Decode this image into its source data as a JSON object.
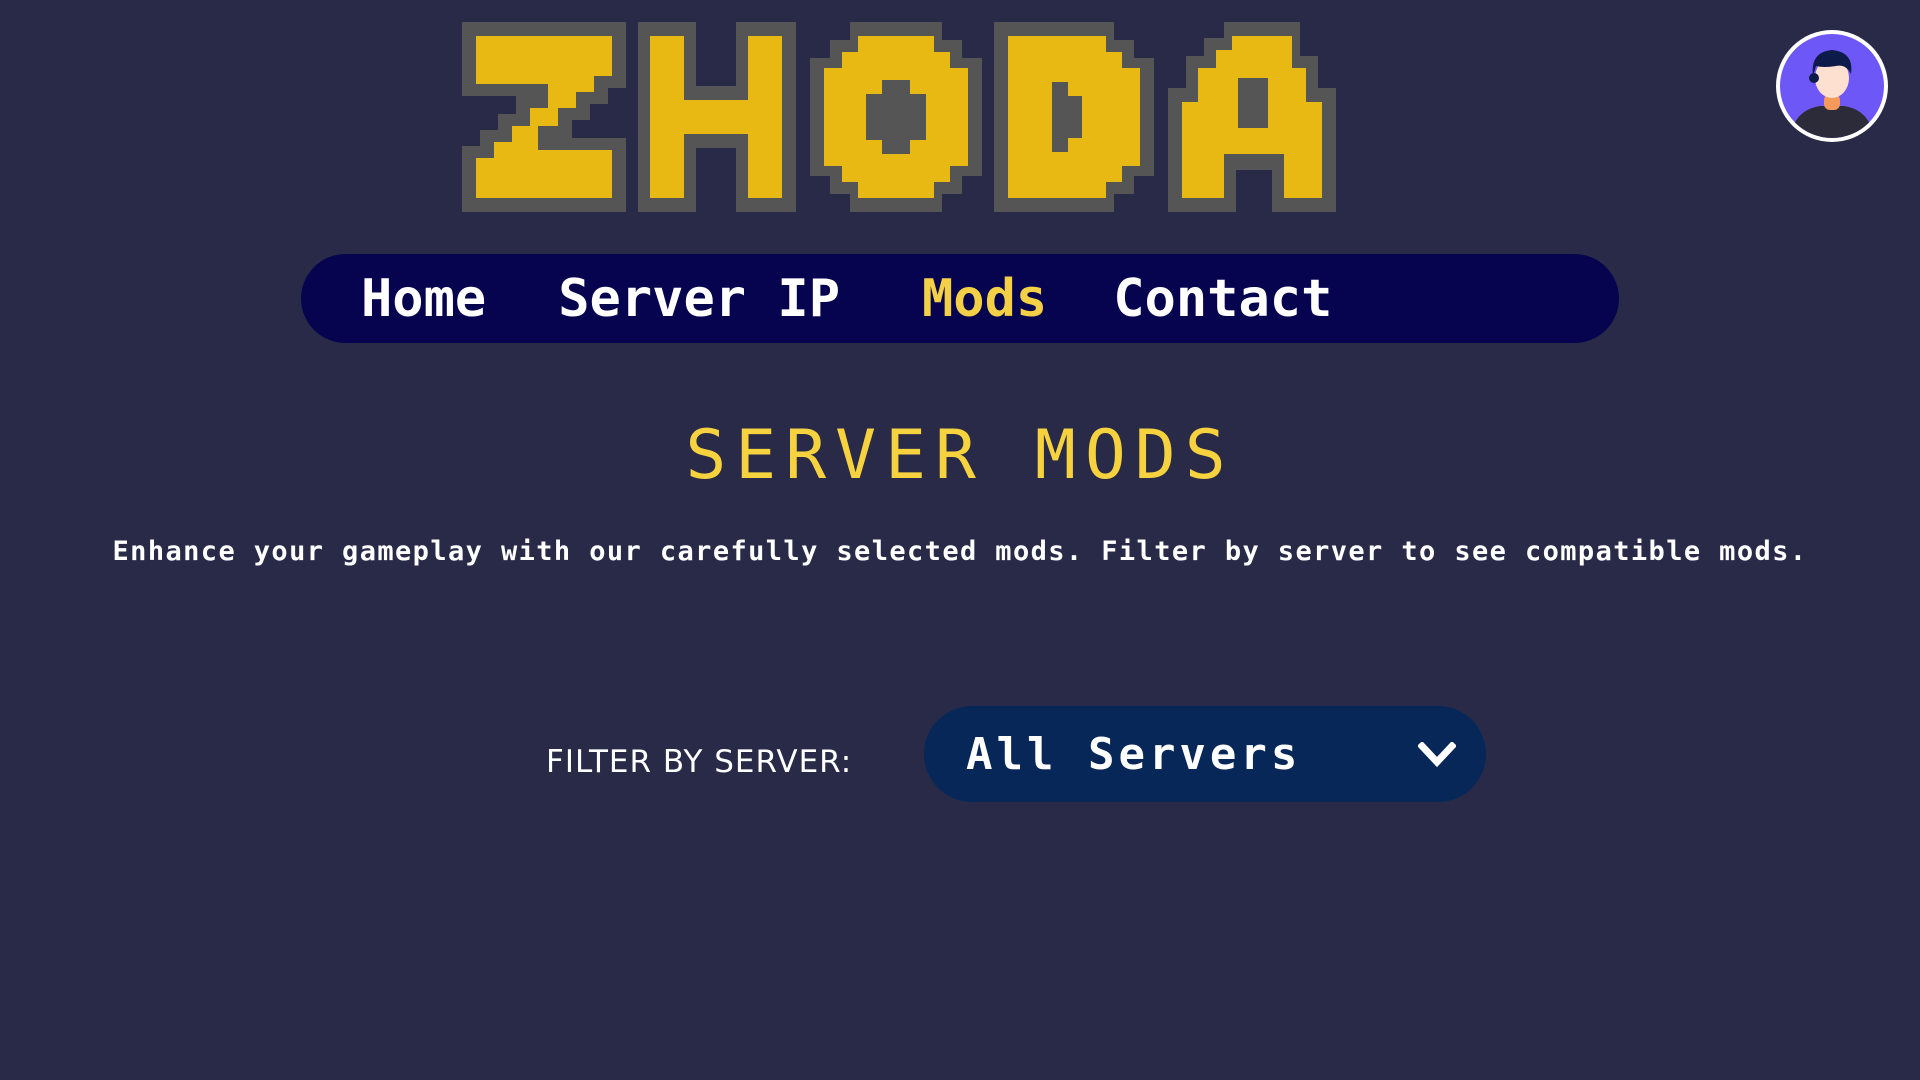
{
  "logo": {
    "text": "ZHODA",
    "colors": {
      "fill": "#e8b913",
      "outline": "#555555"
    }
  },
  "avatar": {
    "icon": "user-avatar-icon",
    "colors": {
      "bg": "#6e57f7",
      "ring": "#ffffff"
    }
  },
  "nav": {
    "items": [
      {
        "label": "Home",
        "active": false
      },
      {
        "label": "Server IP",
        "active": false
      },
      {
        "label": "Mods",
        "active": true
      },
      {
        "label": "Contact",
        "active": false
      }
    ],
    "colors": {
      "bg": "#06034f",
      "text": "#ffffff",
      "active": "#f3d046"
    }
  },
  "main": {
    "title": "SERVER MODS",
    "description": "Enhance your gameplay with our carefully selected mods. Filter by server to see compatible mods."
  },
  "filter": {
    "label": "FILTER BY SERVER:",
    "selected": "All Servers",
    "icon": "chevron-down-icon"
  },
  "colors": {
    "page_bg": "#292a48",
    "accent": "#f6d23f",
    "select_bg": "#062758"
  }
}
